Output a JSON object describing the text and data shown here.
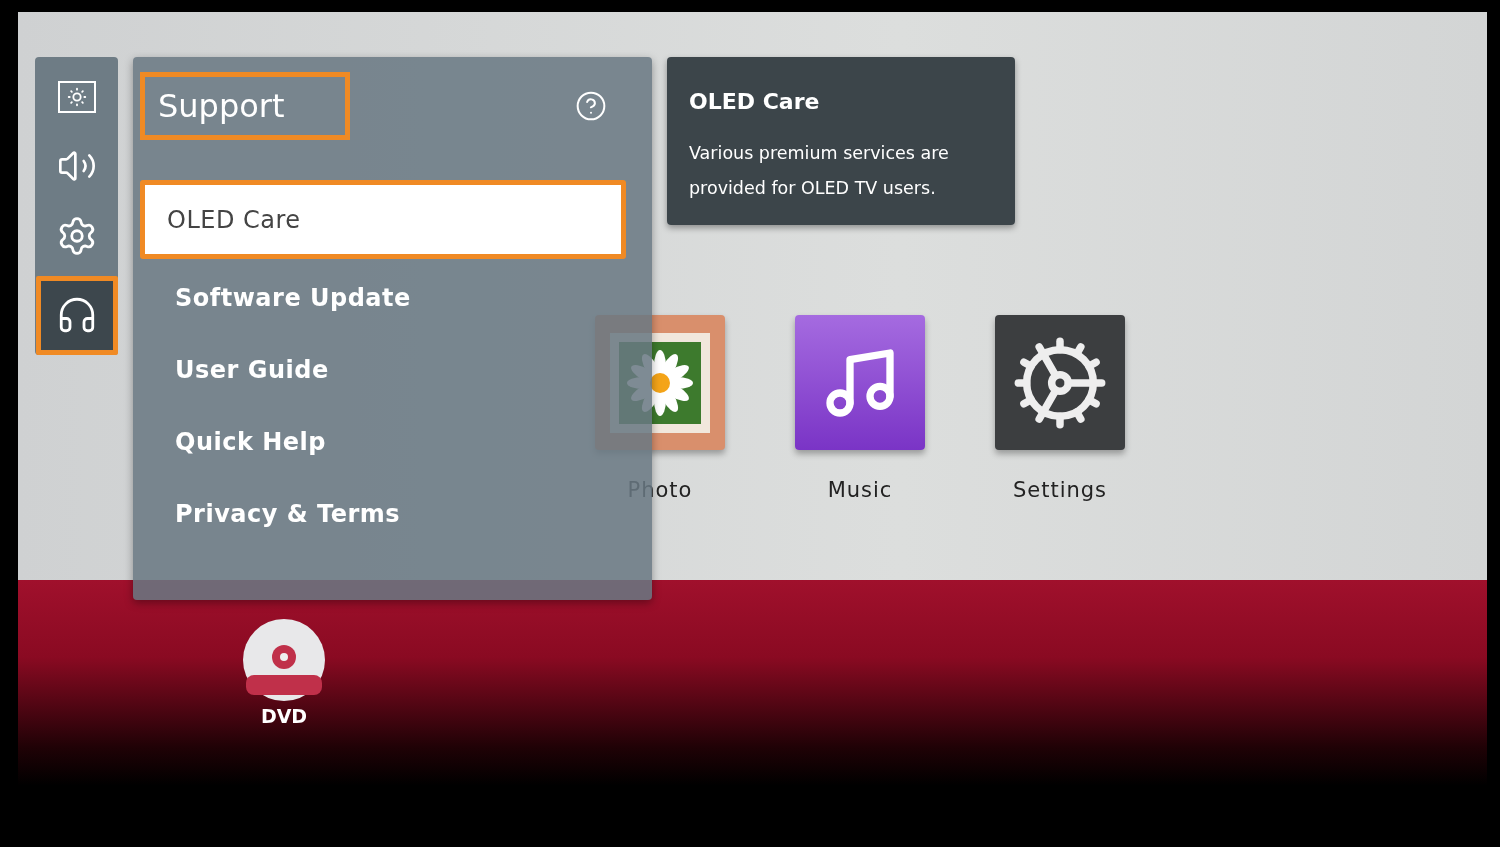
{
  "sidebar": {
    "items": [
      {
        "kind": "picture",
        "selected": false
      },
      {
        "kind": "sound",
        "selected": false
      },
      {
        "kind": "settings",
        "selected": false
      },
      {
        "kind": "support",
        "selected": true
      }
    ]
  },
  "panel": {
    "title": "Support",
    "title_highlighted": true,
    "items": [
      {
        "label": "OLED Care",
        "selected": true
      },
      {
        "label": "Software Update",
        "selected": false
      },
      {
        "label": "User Guide",
        "selected": false
      },
      {
        "label": "Quick Help",
        "selected": false
      },
      {
        "label": "Privacy & Terms",
        "selected": false
      }
    ]
  },
  "tooltip": {
    "title": "OLED Care",
    "text": "Various premium services are provided for OLED TV users."
  },
  "launcher": {
    "apps": [
      {
        "label": "Photo",
        "kind": "photo",
        "selected": false
      },
      {
        "label": "Music",
        "kind": "music",
        "selected": false
      },
      {
        "label": "Settings",
        "kind": "settings",
        "selected": false
      }
    ]
  },
  "inputs": [
    {
      "label": "DVD",
      "kind": "dvd"
    }
  ]
}
